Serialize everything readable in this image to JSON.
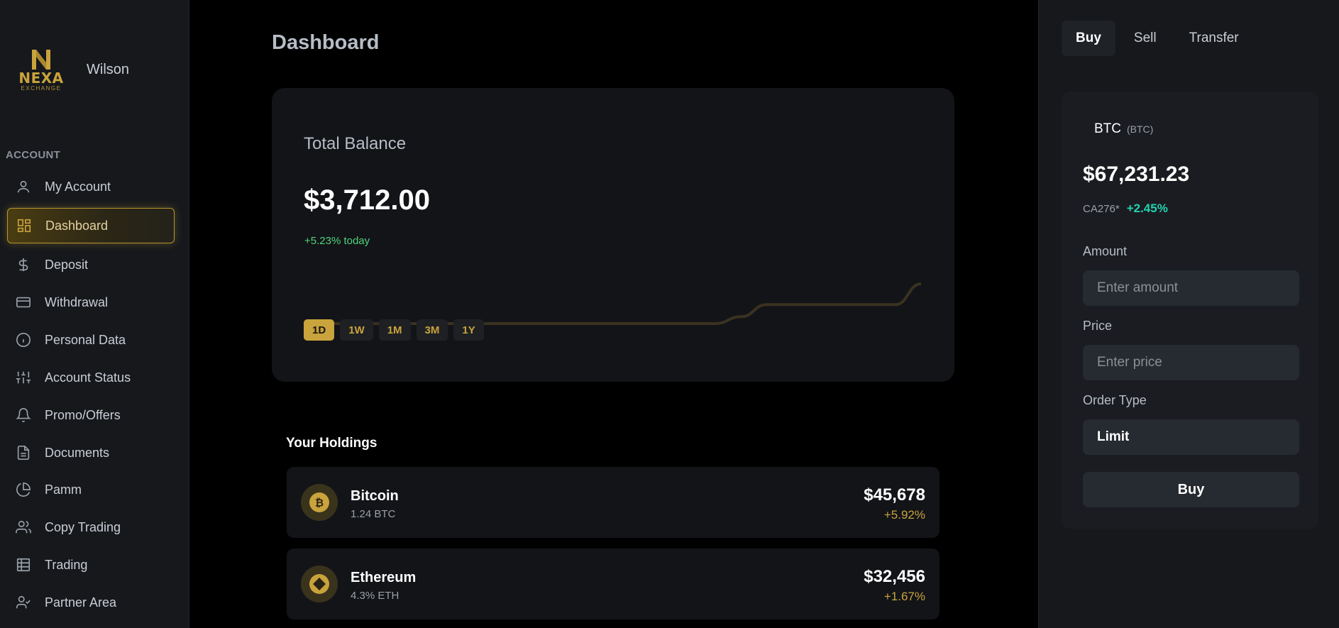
{
  "brand": {
    "logo_text": "NEXA",
    "logo_sub": "EXCHANGE",
    "logo_letter": "N"
  },
  "user": {
    "name": "Wilson"
  },
  "sidebar": {
    "section_label": "ACCOUNT",
    "items": [
      {
        "label": "My Account",
        "icon": "user-icon"
      },
      {
        "label": "Dashboard",
        "icon": "grid-icon",
        "active": true
      },
      {
        "label": "Deposit",
        "icon": "dollar-icon"
      },
      {
        "label": "Withdrawal",
        "icon": "card-icon"
      },
      {
        "label": "Personal Data",
        "icon": "info-icon"
      },
      {
        "label": "Account Status",
        "icon": "sliders-icon"
      },
      {
        "label": "Promo/Offers",
        "icon": "bell-icon"
      },
      {
        "label": "Documents",
        "icon": "document-icon"
      },
      {
        "label": "Pamm",
        "icon": "pie-chart-icon"
      },
      {
        "label": "Copy Trading",
        "icon": "users-icon"
      },
      {
        "label": "Trading",
        "icon": "table-icon"
      },
      {
        "label": "Partner Area",
        "icon": "user-check-icon"
      }
    ]
  },
  "main": {
    "title": "Dashboard",
    "balance": {
      "label": "Total Balance",
      "value": "$3,712.00",
      "change": "+5.23% today",
      "ranges": [
        "1D",
        "1W",
        "1M",
        "3M",
        "1Y"
      ],
      "active_range": "1D"
    },
    "holdings": {
      "title": "Your Holdings",
      "items": [
        {
          "name": "Bitcoin",
          "amount": "1.24 BTC",
          "value": "$45,678",
          "change": "+5.92%",
          "icon": "bitcoin-icon"
        },
        {
          "name": "Ethereum",
          "amount": "4.3% ETH",
          "value": "$32,456",
          "change": "+1.67%",
          "icon": "ethereum-icon"
        }
      ]
    }
  },
  "chart_data": {
    "type": "line",
    "title": "",
    "xlabel": "",
    "ylabel": "",
    "x": [
      0,
      1,
      2,
      3,
      4,
      5,
      6,
      7,
      8,
      9,
      10,
      11,
      12,
      13,
      14,
      15,
      16,
      17,
      18,
      19,
      20,
      21,
      22,
      23,
      24
    ],
    "values": [
      0,
      0,
      0,
      0,
      0,
      0,
      0,
      0,
      0,
      0,
      0,
      0,
      0,
      0,
      0,
      0,
      0,
      4,
      11,
      11,
      11,
      11,
      11,
      11,
      23
    ],
    "color": "#3a3220"
  },
  "trade": {
    "tabs": [
      "Buy",
      "Sell",
      "Transfer"
    ],
    "active_tab": "Buy",
    "pair_symbol": "BTC",
    "pair_sub": "(BTC)",
    "price": "$67,231.23",
    "price_code": "CA276*",
    "price_change": "+2.45%",
    "amount_label": "Amount",
    "amount_placeholder": "Enter amount",
    "price_label": "Price",
    "price_placeholder": "Enter price",
    "order_type_label": "Order Type",
    "order_type_value": "Limit",
    "submit_label": "Buy"
  },
  "colors": {
    "accent": "#c9a33c",
    "positive": "#4fd47a",
    "teal": "#22d3b0"
  }
}
